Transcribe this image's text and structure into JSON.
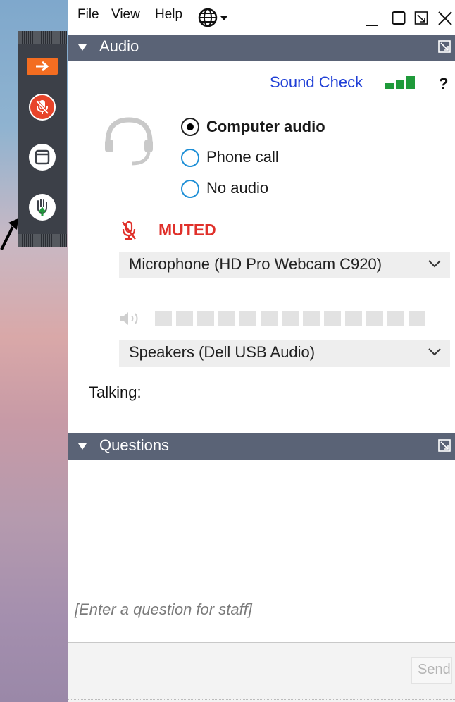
{
  "menubar": {
    "items": [
      "File",
      "View",
      "Help"
    ],
    "globe_icon": "globe-icon",
    "window_controls": [
      "minimize-icon",
      "maximize-icon",
      "restore-icon",
      "close-icon"
    ]
  },
  "audio_panel": {
    "title": "Audio",
    "sound_check": "Sound Check",
    "help": "?",
    "options": [
      {
        "label": "Computer audio",
        "selected": true
      },
      {
        "label": "Phone call",
        "selected": false
      },
      {
        "label": "No audio",
        "selected": false
      }
    ],
    "mute_status": "MUTED",
    "microphone": "Microphone (HD Pro Webcam C920)",
    "speakers": "Speakers (Dell USB Audio)",
    "talking_label": "Talking:",
    "level_segments": 13
  },
  "questions_panel": {
    "title": "Questions",
    "input_placeholder": "[Enter a question for staff]",
    "send_label": "Send"
  },
  "toolbar": {
    "items": [
      "arrow-icon",
      "mic-muted-icon",
      "screen-icon",
      "raise-hand-icon"
    ]
  },
  "colors": {
    "accent_orange": "#f36d21",
    "muted_red": "#e0302a",
    "header_bg": "#5a6376",
    "link_blue": "#1f3fd6",
    "signal_green": "#1f9a3a"
  }
}
